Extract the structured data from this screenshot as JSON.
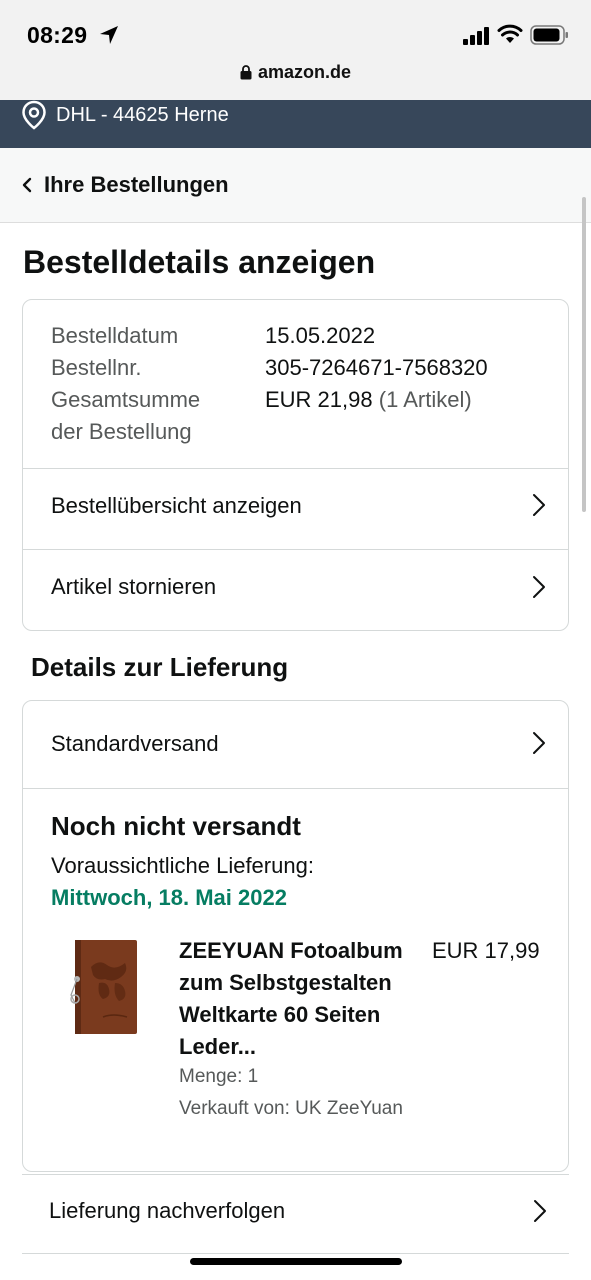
{
  "status_bar": {
    "time": "08:29",
    "url": "amazon.de",
    "icons": [
      "location-arrow-icon",
      "signal-icon",
      "wifi-icon",
      "battery-icon",
      "lock-icon"
    ]
  },
  "location_bar": {
    "text": "DHL - 44625 Herne",
    "icon": "pin-icon",
    "background": "#37475a"
  },
  "nav": {
    "back_label": "Ihre Bestellungen"
  },
  "page": {
    "title": "Bestelldetails anzeigen"
  },
  "order_info": {
    "date_label": "Bestelldatum",
    "date_value": "15.05.2022",
    "number_label": "Bestellnr.",
    "number_value": "305-7264671-7568320",
    "total_label_line1": "Gesamtsumme",
    "total_label_line2": "der Bestellung",
    "total_value": "EUR 21,98",
    "total_items": "(1 Artikel)"
  },
  "actions": {
    "overview": "Bestellübersicht anzeigen",
    "cancel": "Artikel stornieren"
  },
  "delivery": {
    "section_title": "Details zur Lieferung",
    "method": "Standardversand",
    "status": "Noch nicht versandt",
    "expected_label": "Voraussichtliche Lieferung:",
    "expected_date": "Mittwoch, 18. Mai 2022",
    "expected_date_color": "#067d62",
    "track": "Lieferung nachverfolgen"
  },
  "product": {
    "title_lines": [
      "ZEEYUAN Fotoalbum",
      "zum Selbstgestalten",
      "Weltkarte 60 Seiten",
      "Leder..."
    ],
    "price": "EUR 17,99",
    "quantity": "Menge: 1",
    "seller": "Verkauft von: UK ZeeYuan"
  }
}
